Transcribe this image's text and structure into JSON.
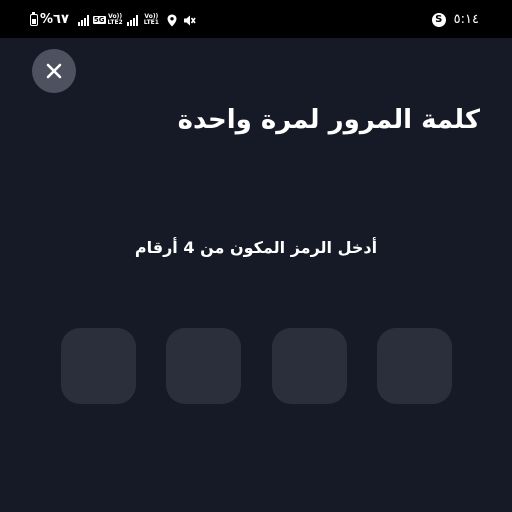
{
  "status_bar": {
    "battery_percent": "%٦٧",
    "network_5g": "5G",
    "volte1": "Vo))",
    "lte1": "LTE1",
    "volte2": "Vo))",
    "lte2": "LTE2",
    "s_badge": "S",
    "time": "٥:١٤",
    "icons": [
      "battery-icon",
      "signal-icon",
      "5g-icon",
      "location-icon",
      "mute-icon"
    ]
  },
  "header": {
    "close_icon": "close-icon",
    "title": "كلمة المرور لمرة واحدة"
  },
  "main": {
    "prompt": "أدخل الرمز المكون من 4 أرقام",
    "pin_length": 4,
    "pin_values": [
      "",
      "",
      "",
      ""
    ]
  },
  "colors": {
    "background": "#161a26",
    "status_bar": "#000000",
    "close_button": "#4d5160",
    "pin_box": "#2b2f3c",
    "text": "#ffffff"
  }
}
